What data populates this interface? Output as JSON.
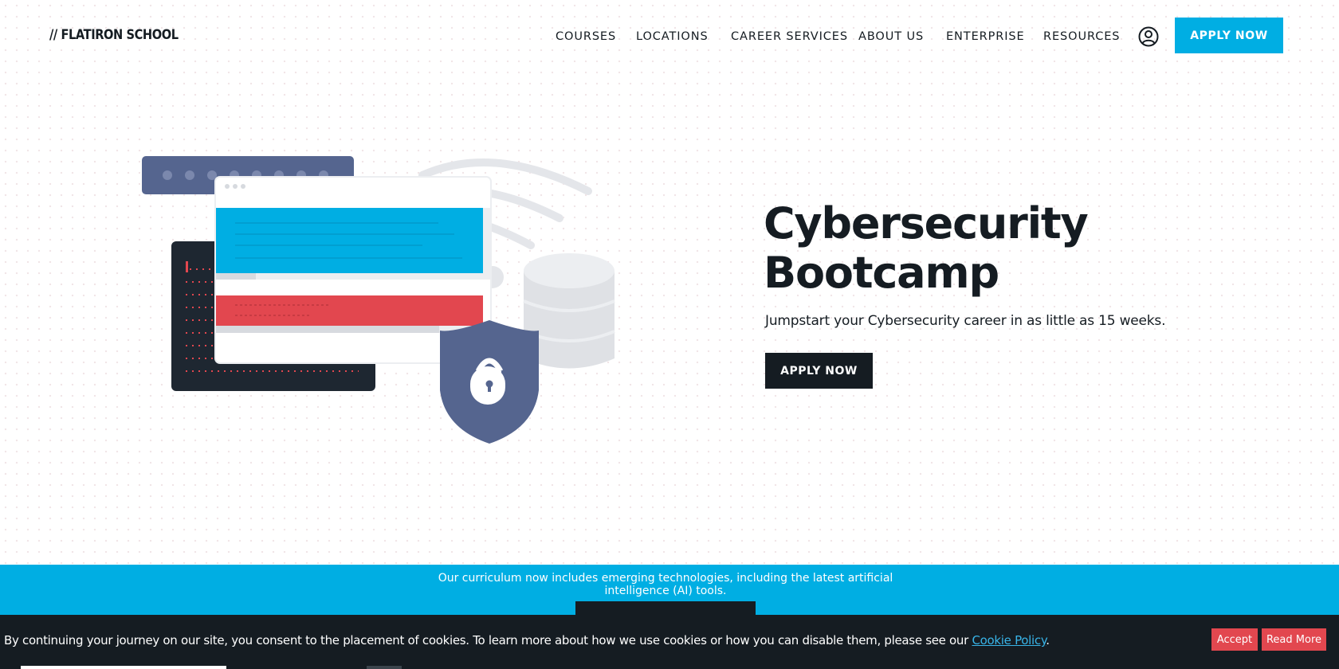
{
  "header": {
    "logo_text": "// FLATIRON SCHOOL",
    "nav": [
      {
        "label": "COURSES"
      },
      {
        "label": "LOCATIONS"
      },
      {
        "label": "CAREER SERVICES"
      },
      {
        "label": "ABOUT US"
      },
      {
        "label": "ENTERPRISE"
      },
      {
        "label": "RESOURCES"
      }
    ],
    "account_icon": "user-circle-icon",
    "apply_label": "APPLY NOW"
  },
  "hero": {
    "title_line1": "Cybersecurity",
    "title_line2": "Bootcamp",
    "subtitle": "Jumpstart your Cybersecurity career in as little as 15 weeks.",
    "apply_label": "APPLY NOW"
  },
  "banner": {
    "text": "Our curriculum now includes emerging technologies, including the latest artificial intelligence (AI) tools."
  },
  "cookie": {
    "text": "By continuing your journey on our site, you consent to the placement of cookies. To learn more about how we use cookies or how you can disable them, please see our ",
    "link_text": "Cookie Policy",
    "suffix": ".",
    "accept_label": "Accept",
    "read_more_label": "Read More"
  },
  "colors": {
    "brand_blue": "#00aee3",
    "dark": "#151c22",
    "red": "#e2474f",
    "shield_blue": "#55658f"
  }
}
